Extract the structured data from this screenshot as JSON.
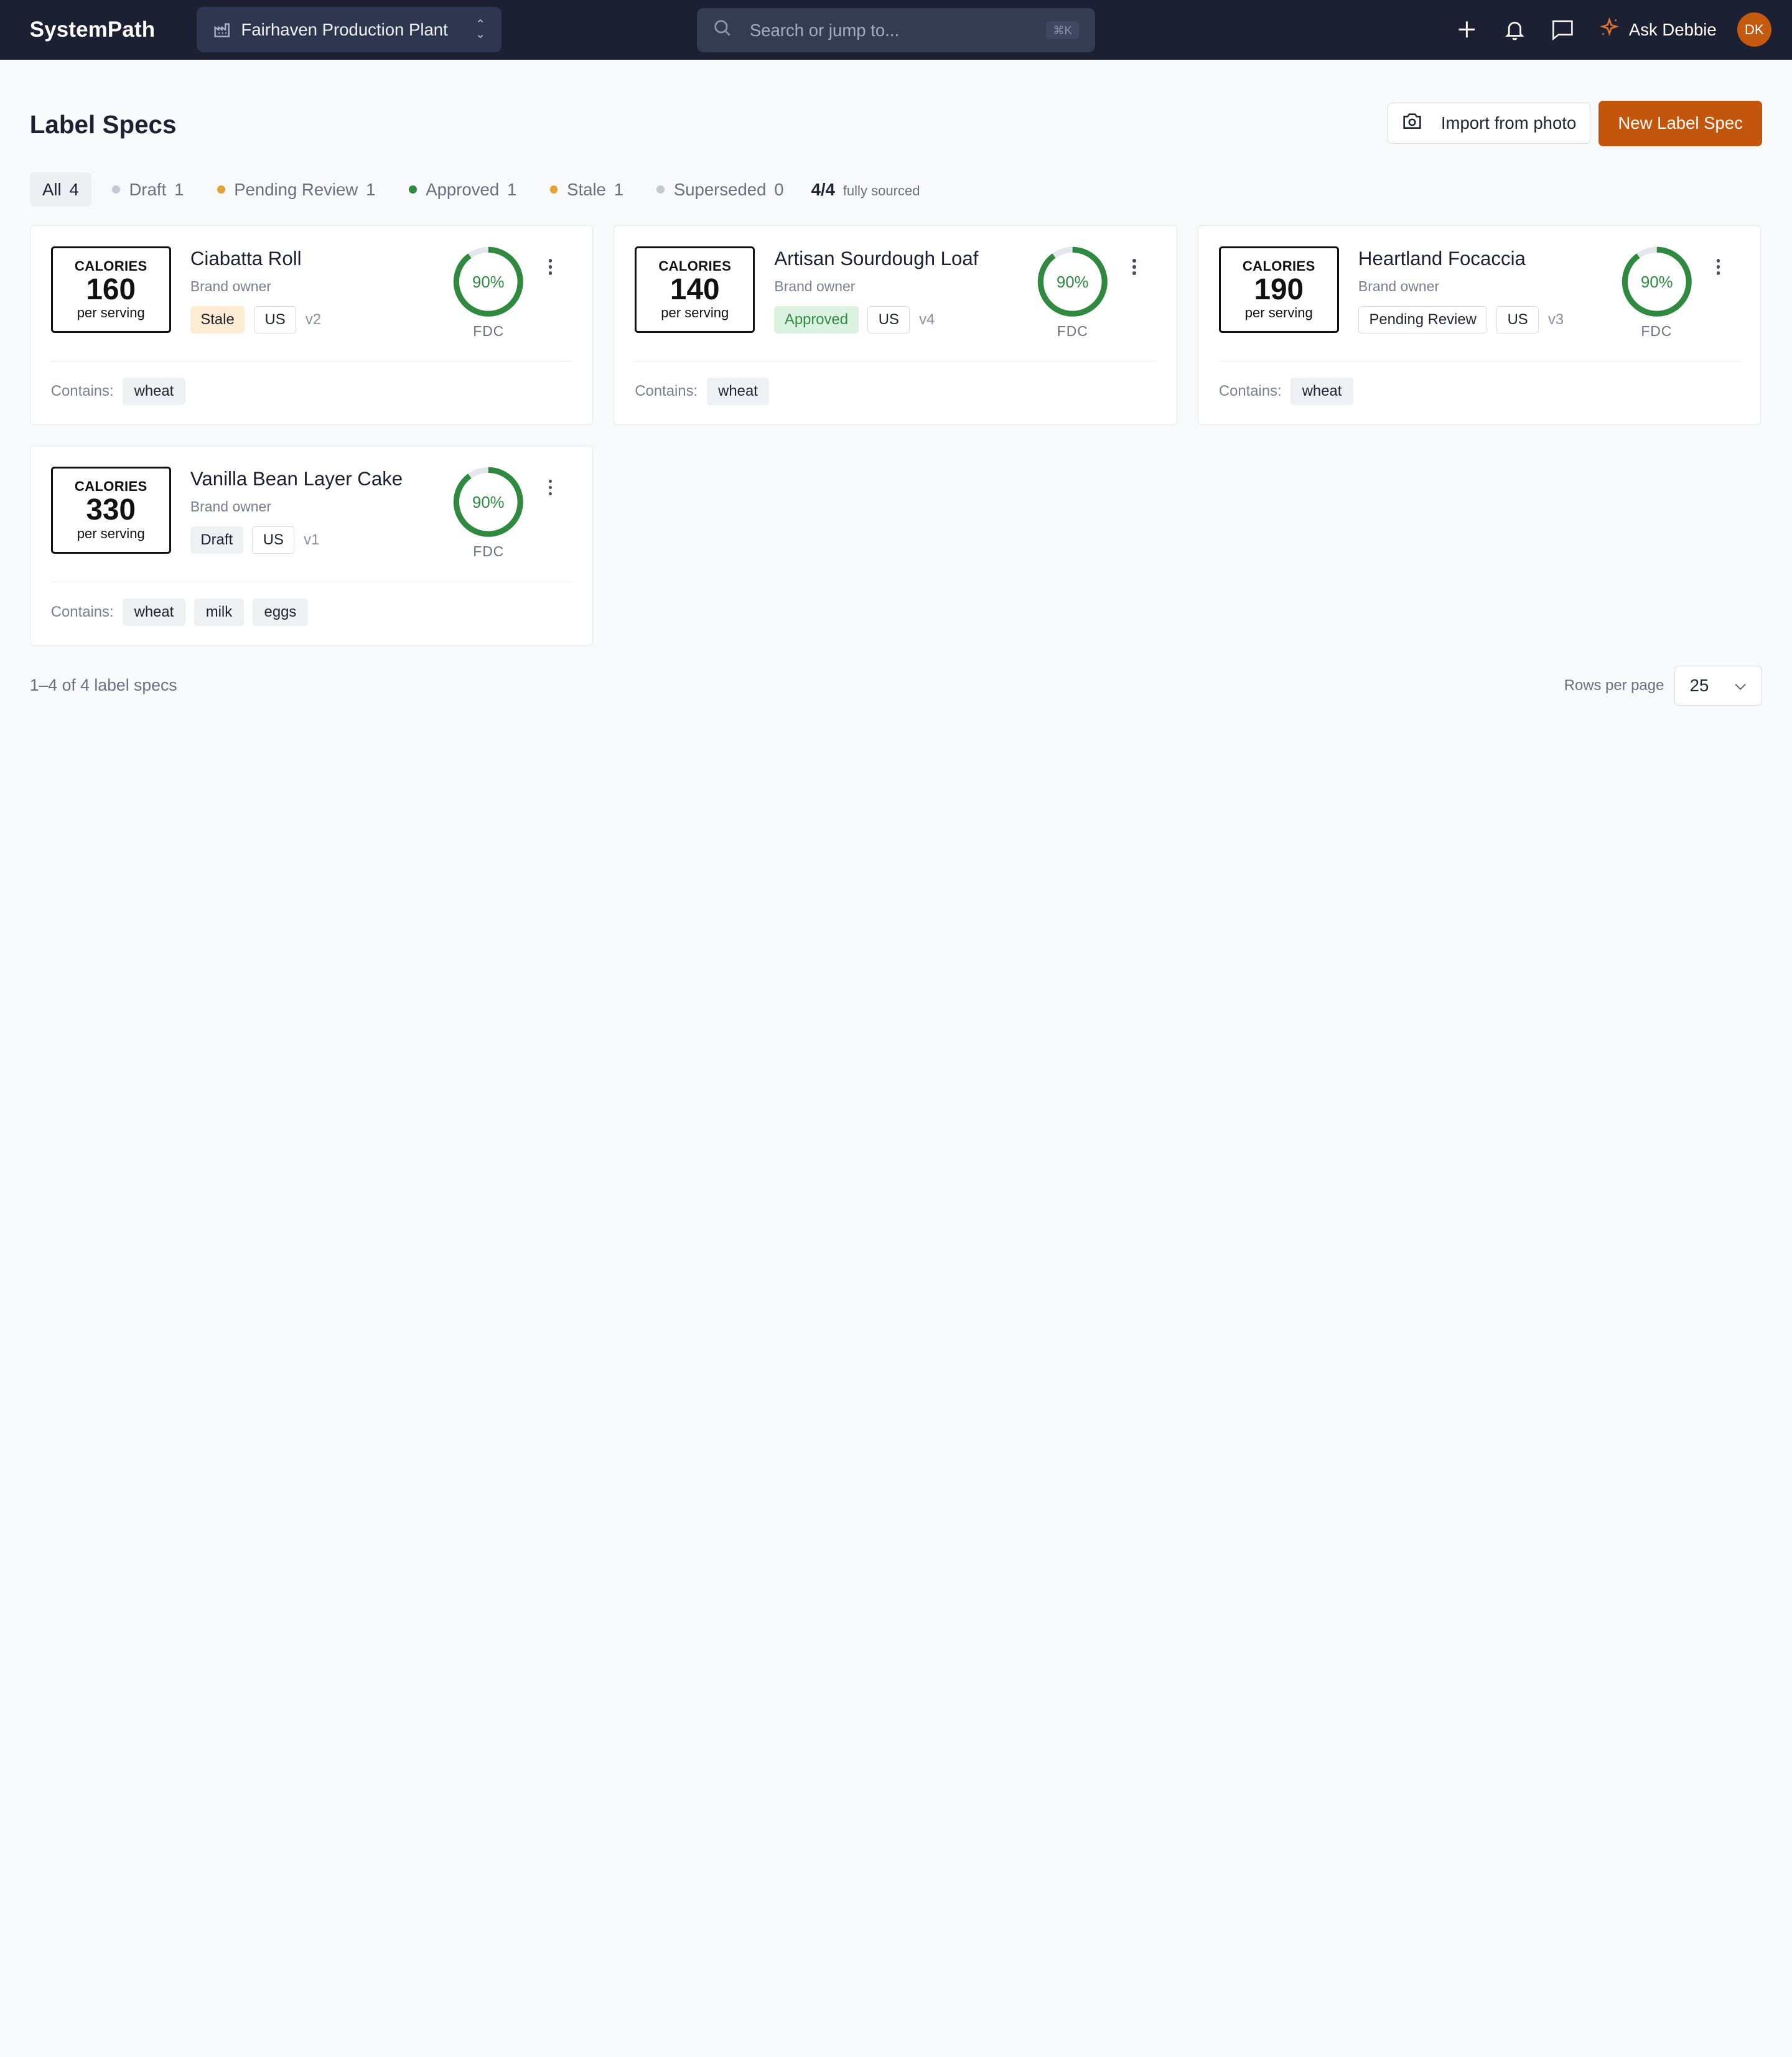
{
  "app": {
    "name": "SystemPath"
  },
  "plant": {
    "name": "Fairhaven Production Plant",
    "icon": "factory-icon"
  },
  "search": {
    "placeholder": "Search or jump to...",
    "shortcut": "⌘K"
  },
  "topbar": {
    "assistant_label": "Ask Debbie",
    "avatar_initials": "DK",
    "accent_color": "#c3560c"
  },
  "page": {
    "title": "Label Specs",
    "import_label": "Import from photo",
    "new_label": "New Label Spec"
  },
  "filters": [
    {
      "label": "All",
      "count": "4",
      "dot": ""
    },
    {
      "label": "Draft",
      "count": "1",
      "dot": "#c4c8d0"
    },
    {
      "label": "Pending Review",
      "count": "1",
      "dot": "#e5a23a"
    },
    {
      "label": "Approved",
      "count": "1",
      "dot": "#2f8a3f"
    },
    {
      "label": "Stale",
      "count": "1",
      "dot": "#e5a23a"
    },
    {
      "label": "Superseded",
      "count": "0",
      "dot": "#c4c8d0"
    }
  ],
  "sourced": {
    "value": "4/4",
    "label": "fully sourced"
  },
  "cards": [
    {
      "calories_label": "CALORIES",
      "calories": "160",
      "per": "per serving",
      "name": "Ciabatta Roll",
      "owner": "Brand owner",
      "status": "Stale",
      "status_class": "status-stale",
      "region": "US",
      "version": "v2",
      "score": "90%",
      "score_fraction": 0.9,
      "source": "FDC",
      "contains_label": "Contains:",
      "allergens": [
        "wheat"
      ]
    },
    {
      "calories_label": "CALORIES",
      "calories": "140",
      "per": "per serving",
      "name": "Artisan Sourdough Loaf",
      "owner": "Brand owner",
      "status": "Approved",
      "status_class": "status-approved",
      "region": "US",
      "version": "v4",
      "score": "90%",
      "score_fraction": 0.9,
      "source": "FDC",
      "contains_label": "Contains:",
      "allergens": [
        "wheat"
      ]
    },
    {
      "calories_label": "CALORIES",
      "calories": "190",
      "per": "per serving",
      "name": "Heartland Focaccia",
      "owner": "Brand owner",
      "status": "Pending Review",
      "status_class": "status-pending",
      "region": "US",
      "version": "v3",
      "score": "90%",
      "score_fraction": 0.9,
      "source": "FDC",
      "contains_label": "Contains:",
      "allergens": [
        "wheat"
      ]
    },
    {
      "calories_label": "CALORIES",
      "calories": "330",
      "per": "per serving",
      "name": "Vanilla Bean Layer Cake",
      "owner": "Brand owner",
      "status": "Draft",
      "status_class": "status-draft",
      "region": "US",
      "version": "v1",
      "score": "90%",
      "score_fraction": 0.9,
      "source": "FDC",
      "contains_label": "Contains:",
      "allergens": [
        "wheat",
        "milk",
        "eggs"
      ]
    }
  ],
  "footer": {
    "range": "1–4 of 4 label specs",
    "rows_label": "Rows per page",
    "rows_value": "25"
  },
  "colors": {
    "gauge": "#2f8a3f",
    "gauge_track": "#e3e6ea"
  }
}
